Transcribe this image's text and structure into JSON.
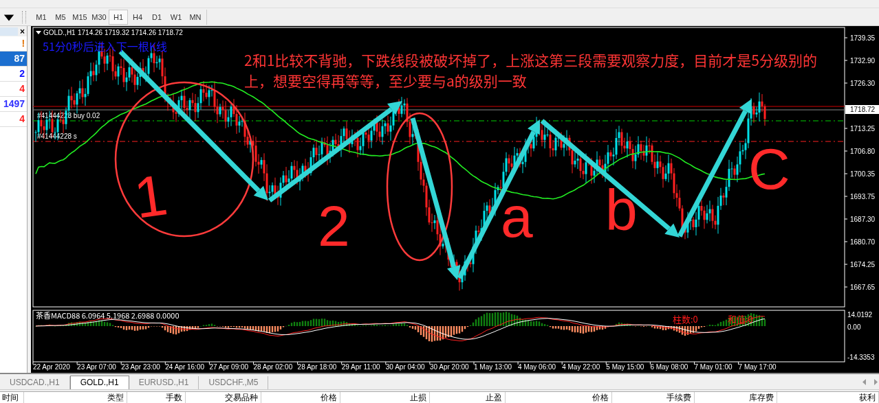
{
  "timeframe_toolbar": {
    "timeframes": [
      {
        "label": "M1",
        "selected": false
      },
      {
        "label": "M5",
        "selected": false
      },
      {
        "label": "M15",
        "selected": false
      },
      {
        "label": "M30",
        "selected": false
      },
      {
        "label": "H1",
        "selected": true
      },
      {
        "label": "H4",
        "selected": false
      },
      {
        "label": "D1",
        "selected": false
      },
      {
        "label": "W1",
        "selected": false
      },
      {
        "label": "MN",
        "selected": false
      }
    ]
  },
  "navigator_panel": {
    "close": "×",
    "rows": [
      {
        "value": "!",
        "color": "#e07000",
        "selected": false
      },
      {
        "value": "87",
        "color": "#ffffff",
        "selected": true
      },
      {
        "value": "2",
        "color": "#1010ff",
        "selected": false
      },
      {
        "value": "4",
        "color": "#ff2020",
        "selected": false
      },
      {
        "value": "1497",
        "color": "#3030ff",
        "selected": false
      },
      {
        "value": "4",
        "color": "#ff2020",
        "selected": false
      }
    ]
  },
  "chart": {
    "symbol": "GOLD.,H1",
    "ohlc": "1714.26 1719.32 1714.26 1718.72",
    "countdown": "51分0秒后进入下一根K线",
    "annotation": "2和1比较不背驰，下跌线段被破坏掉了，上涨这第三段需要观察力度，目前才是5分级别的上，想要空得再等等，至少要与a的级别一致",
    "hand_labels": [
      "1",
      "2",
      "a",
      "b",
      "C"
    ],
    "orders": [
      {
        "label": "#41444228 buy 0.02",
        "kind": "buy"
      },
      {
        "label": "#41444228 s",
        "kind": "sell"
      }
    ],
    "price_axis": [
      "1739.35",
      "1732.90",
      "1726.30",
      "1713.25",
      "1706.80",
      "1700.35",
      "1693.75",
      "1687.30",
      "1680.70",
      "1674.25",
      "1667.65"
    ],
    "current_price": "1718.72",
    "time_axis": [
      "22 Apr 2020",
      "23 Apr 07:00",
      "23 Apr 23:00",
      "24 Apr 16:00",
      "27 Apr 09:00",
      "28 Apr 02:00",
      "28 Apr 18:00",
      "29 Apr 11:00",
      "30 Apr 04:00",
      "30 Apr 20:00",
      "1 May 13:00",
      "4 May 06:00",
      "4 May 22:00",
      "5 May 15:00",
      "6 May 08:00",
      "7 May 01:00",
      "7 May 17:00"
    ]
  },
  "macd": {
    "label": "茶香MACD88 6.0964 5.1968 2.6988 0.0000",
    "bar_count": "柱数:0",
    "sum": "和值:0",
    "axis": [
      "14.0192",
      "0.00",
      "-14.3353"
    ]
  },
  "chart_tabs": [
    {
      "label": "USDCAD.,H1",
      "selected": false
    },
    {
      "label": "GOLD.,H1",
      "selected": true
    },
    {
      "label": "EURUSD.,H1",
      "selected": false
    },
    {
      "label": "USDCHF.,M5",
      "selected": false
    }
  ],
  "orders_table": {
    "columns": [
      "时间",
      "类型",
      "手数",
      "交易品种",
      "价格",
      "止损",
      "止盈",
      "价格",
      "手续费",
      "库存费",
      "获利"
    ]
  }
}
